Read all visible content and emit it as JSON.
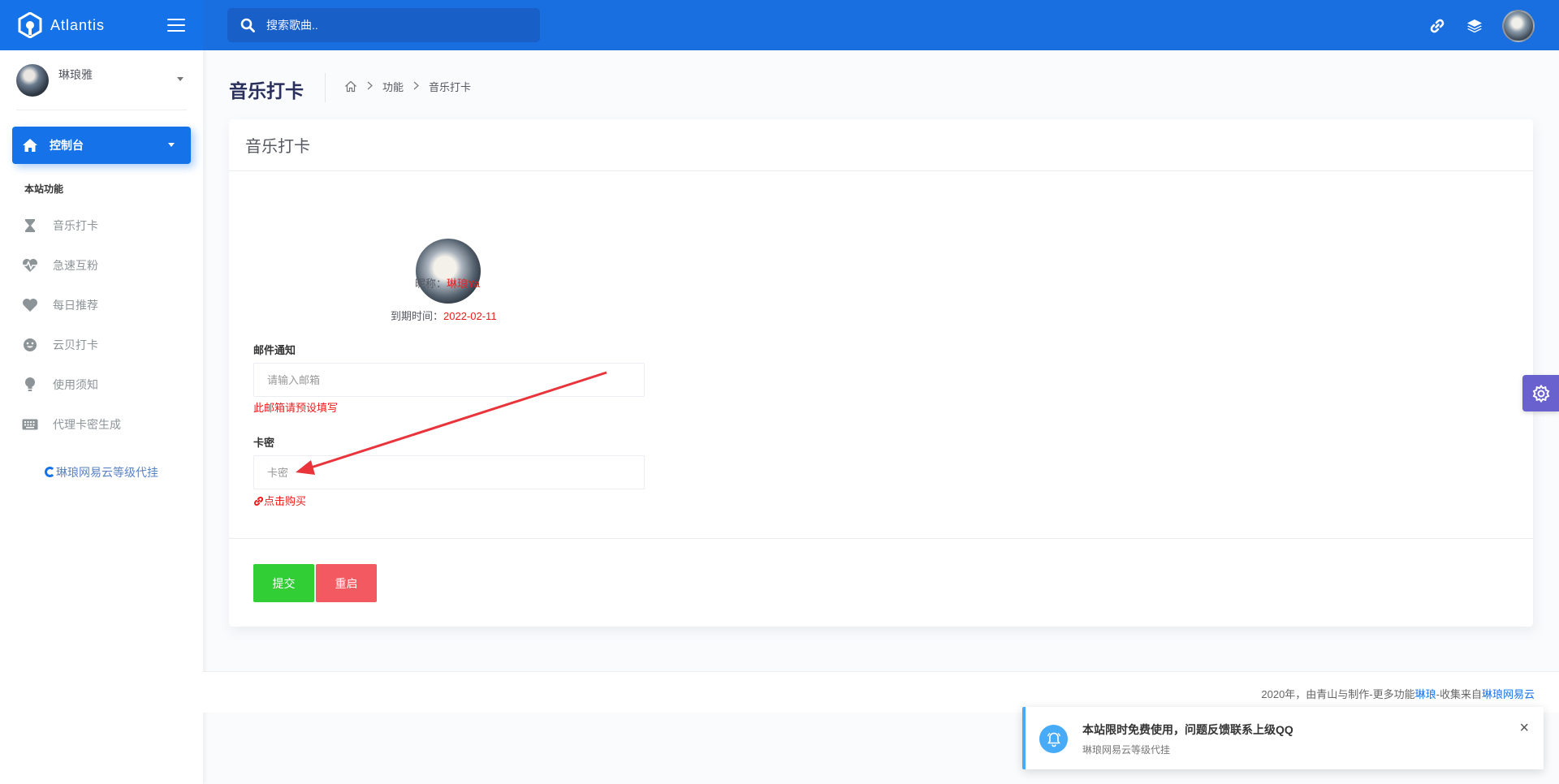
{
  "app": {
    "name": "Atlantis"
  },
  "search": {
    "placeholder": "搜索歌曲.."
  },
  "user": {
    "name": "琳琅雅"
  },
  "sidebar": {
    "active_item": "控制台",
    "section_title": "本站功能",
    "items": [
      {
        "label": "音乐打卡",
        "icon": "hourglass-icon"
      },
      {
        "label": "急速互粉",
        "icon": "heartbeat-icon"
      },
      {
        "label": "每日推荐",
        "icon": "heart-icon"
      },
      {
        "label": "云贝打卡",
        "icon": "smile-icon"
      },
      {
        "label": "使用须知",
        "icon": "lightbulb-icon"
      },
      {
        "label": "代理卡密生成",
        "icon": "keyboard-icon"
      }
    ],
    "promo_link": "琳琅网易云等级代挂"
  },
  "page": {
    "title": "音乐打卡",
    "breadcrumb": [
      "功能",
      "音乐打卡"
    ]
  },
  "card": {
    "title": "音乐打卡",
    "nickname_label": "昵称：",
    "nickname_value": "琳琅Ya",
    "expiry_label": "到期时间：",
    "expiry_value": "2022-02-11",
    "email": {
      "label": "邮件通知",
      "placeholder": "请输入邮箱",
      "hint": "此邮箱请预设填写"
    },
    "card_key": {
      "label": "卡密",
      "placeholder": "卡密",
      "buy_link": "点击购买"
    },
    "submit_label": "提交",
    "reset_label": "重启"
  },
  "footer": {
    "prefix": "2020年，由青山与制作-更多功能",
    "link1": "琳琅",
    "middle": "-收集来自",
    "link2": "琳琅网易云"
  },
  "notification": {
    "title": "本站限时免费使用，问题反馈联系上级QQ",
    "message": "琳琅网易云等级代挂",
    "close": "×"
  },
  "colors": {
    "primary": "#1572e8",
    "success": "#31ce36",
    "danger": "#f25961",
    "alert_red": "#f01a1a",
    "info": "#48abf7",
    "secondary": "#6861ce"
  }
}
